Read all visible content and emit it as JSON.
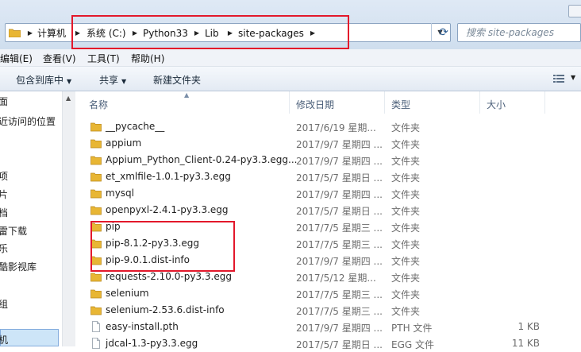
{
  "address_bar": {
    "crumbs": [
      "计算机",
      "系统 (C:)",
      "Python33",
      "Lib",
      "site-packages"
    ],
    "search_placeholder": "搜索 site-packages"
  },
  "menubar": {
    "items": [
      "编辑(E)",
      "查看(V)",
      "工具(T)",
      "帮助(H)"
    ]
  },
  "toolbar": {
    "include_label": "包含到库中",
    "share_label": "共享",
    "new_folder_label": "新建文件夹"
  },
  "nav": {
    "items": [
      "面",
      "近访问的位置",
      "项",
      "片",
      "档",
      "雷下载",
      "乐",
      "酷影视库",
      "组",
      "机"
    ]
  },
  "columns": {
    "name": "名称",
    "date": "修改日期",
    "type": "类型",
    "size": "大小"
  },
  "files": [
    {
      "name": "__pycache__",
      "date": "2017/6/19 星期...",
      "type": "文件夹",
      "size": "",
      "icon": "folder"
    },
    {
      "name": "appium",
      "date": "2017/9/7 星期四 ...",
      "type": "文件夹",
      "size": "",
      "icon": "folder"
    },
    {
      "name": "Appium_Python_Client-0.24-py3.3.egg...",
      "date": "2017/9/7 星期四 ...",
      "type": "文件夹",
      "size": "",
      "icon": "folder"
    },
    {
      "name": "et_xmlfile-1.0.1-py3.3.egg",
      "date": "2017/5/7 星期日 ...",
      "type": "文件夹",
      "size": "",
      "icon": "folder"
    },
    {
      "name": "mysql",
      "date": "2017/9/7 星期四 ...",
      "type": "文件夹",
      "size": "",
      "icon": "folder"
    },
    {
      "name": "openpyxl-2.4.1-py3.3.egg",
      "date": "2017/5/7 星期日 ...",
      "type": "文件夹",
      "size": "",
      "icon": "folder"
    },
    {
      "name": "pip",
      "date": "2017/7/5 星期三 ...",
      "type": "文件夹",
      "size": "",
      "icon": "folder"
    },
    {
      "name": "pip-8.1.2-py3.3.egg",
      "date": "2017/7/5 星期三 ...",
      "type": "文件夹",
      "size": "",
      "icon": "folder"
    },
    {
      "name": "pip-9.0.1.dist-info",
      "date": "2017/9/7 星期四 ...",
      "type": "文件夹",
      "size": "",
      "icon": "folder"
    },
    {
      "name": "requests-2.10.0-py3.3.egg",
      "date": "2017/5/12 星期...",
      "type": "文件夹",
      "size": "",
      "icon": "folder"
    },
    {
      "name": "selenium",
      "date": "2017/7/5 星期三 ...",
      "type": "文件夹",
      "size": "",
      "icon": "folder"
    },
    {
      "name": "selenium-2.53.6.dist-info",
      "date": "2017/7/5 星期三 ...",
      "type": "文件夹",
      "size": "",
      "icon": "folder"
    },
    {
      "name": "easy-install.pth",
      "date": "2017/9/7 星期四 ...",
      "type": "PTH 文件",
      "size": "1 KB",
      "icon": "file"
    },
    {
      "name": "jdcal-1.3-py3.3.egg",
      "date": "2017/5/7 星期日 ...",
      "type": "EGG 文件",
      "size": "11 KB",
      "icon": "egg-file"
    }
  ],
  "colors": {
    "highlight": "#e3182b",
    "folder": "#e8b634",
    "selection": "#cde5f8"
  }
}
